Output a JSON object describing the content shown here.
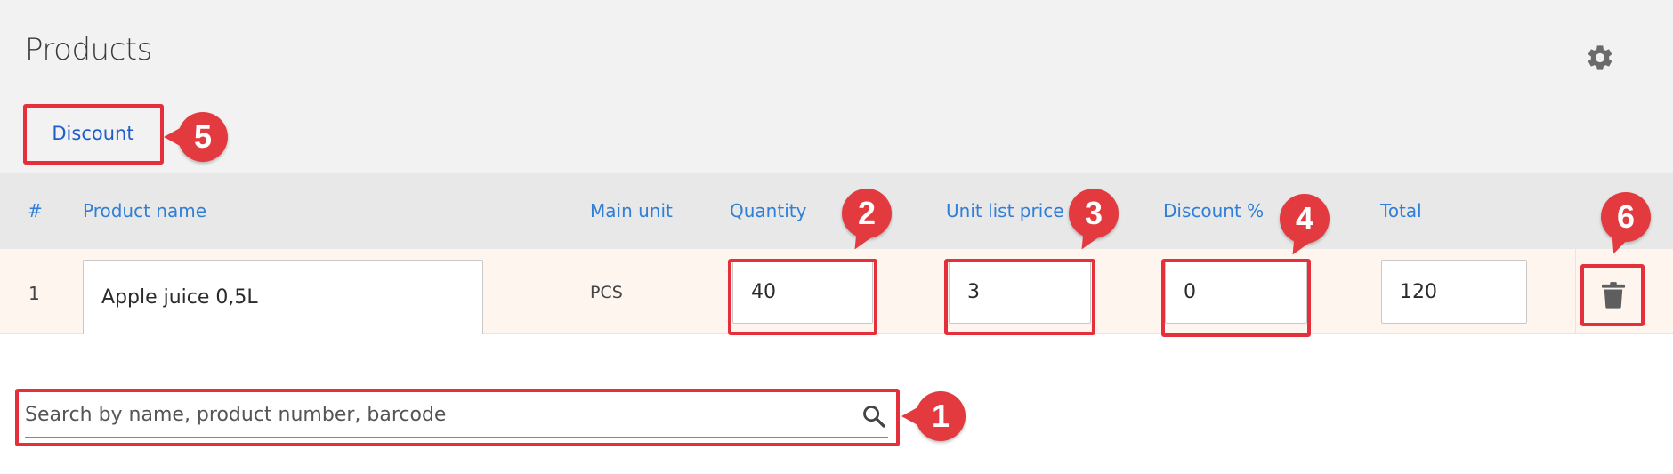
{
  "page": {
    "title": "Products",
    "settings_icon": "gear-icon"
  },
  "tabs": [
    {
      "label": "Discount"
    }
  ],
  "table": {
    "headers": {
      "index": "#",
      "product_name": "Product name",
      "main_unit": "Main unit",
      "quantity": "Quantity",
      "unit_list_price": "Unit list price",
      "discount_pct": "Discount %",
      "total": "Total"
    },
    "rows": [
      {
        "index": "1",
        "product_name": "Apple juice 0,5L",
        "main_unit": "PCS",
        "quantity": "40",
        "unit_list_price": "3",
        "discount_pct": "0",
        "total": "120",
        "delete_icon": "trash-icon"
      }
    ]
  },
  "search": {
    "placeholder": "Search by name, product number, barcode",
    "value": "",
    "icon": "search-icon"
  },
  "annotations": [
    "1",
    "2",
    "3",
    "4",
    "5",
    "6"
  ],
  "colors": {
    "accent_blue": "#2f7ed8",
    "tab_blue": "#1f5ec9",
    "highlight_red": "#e5303b",
    "row_bg": "#fdf5ee",
    "header_bg": "#e8e8e8"
  }
}
